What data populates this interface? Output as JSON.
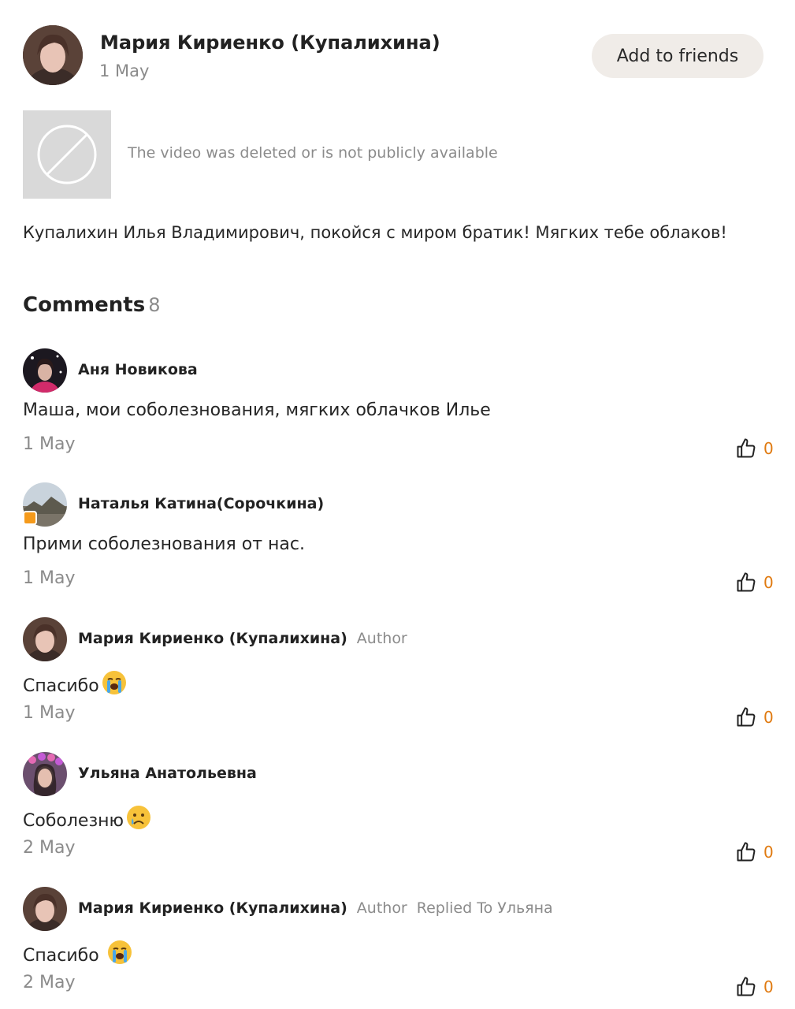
{
  "post": {
    "author": "Мария Кириенко (Купалихина)",
    "date": "1 May",
    "add_friends_label": "Add to friends",
    "video_message": "The video was deleted or is not publicly available",
    "text": "Купалихин Илья Владимирович, покойся с миром братик! Мягких тебе облаков!"
  },
  "comments_header": {
    "title": "Comments",
    "count": "8"
  },
  "comments": [
    {
      "author": "Аня Новикова",
      "tag": "",
      "reply": "",
      "text": "Маша, мои соболезнования, мягких облачков Илье",
      "date": "1 May",
      "likes": "0",
      "emoji": ""
    },
    {
      "author": "Наталья Катина(Сорочкина)",
      "tag": "",
      "reply": "",
      "text": "Прими соболезнования от нас.",
      "date": "1 May",
      "likes": "0",
      "emoji": ""
    },
    {
      "author": "Мария Кириенко (Купалихина)",
      "tag": "Author",
      "reply": "",
      "text": "Спасибо",
      "date": "1 May",
      "likes": "0",
      "emoji": "loudly-crying-face"
    },
    {
      "author": "Ульяна Анатольевна",
      "tag": "",
      "reply": "",
      "text": "Соболезню",
      "date": "2 May",
      "likes": "0",
      "emoji": "crying-face"
    },
    {
      "author": "Мария Кириенко (Купалихина)",
      "tag": "Author",
      "reply": "Replied To Ульяна",
      "text": "Спасибо ",
      "date": "2 May",
      "likes": "0",
      "emoji": "loudly-crying-face"
    }
  ],
  "colors": {
    "like_count": "#e07a10",
    "button_bg": "#f0ece8",
    "muted_text": "#8b8b8b"
  }
}
